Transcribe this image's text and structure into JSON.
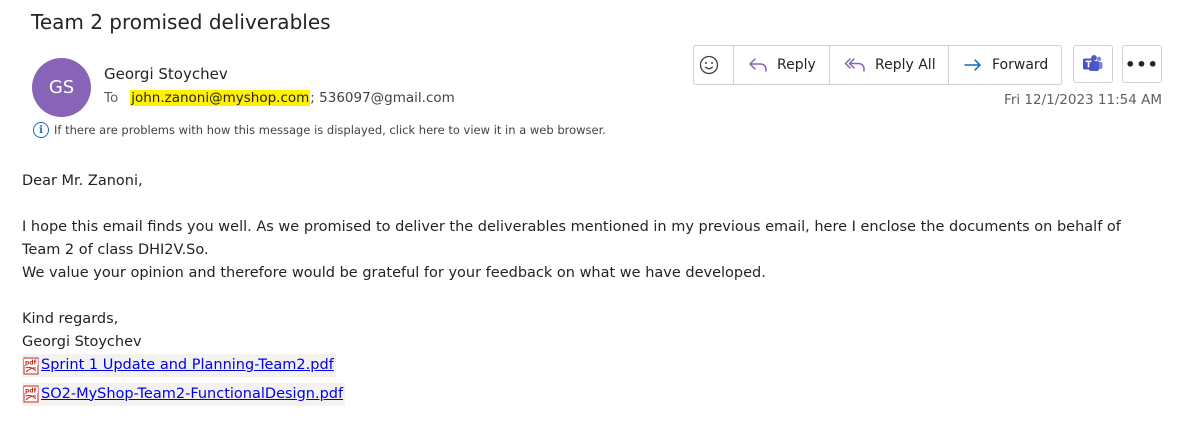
{
  "email": {
    "subject": "Team 2 promised deliverables",
    "avatar_initials": "GS",
    "sender": "Georgi Stoychev",
    "to_label": "To",
    "to_highlighted": "john.zanoni@myshop.com",
    "to_rest": "; 536097@gmail.com",
    "date": "Fri 12/1/2023 11:54 AM",
    "info_notice": "If there are problems with how this message is displayed, click here to view it in a web browser."
  },
  "toolbar": {
    "emoji_icon": "emoji-icon",
    "reply_label": "Reply",
    "reply_all_label": "Reply All",
    "forward_label": "Forward",
    "teams_icon": "teams-icon",
    "more_label": "•••"
  },
  "body": {
    "greeting": "Dear Mr. Zanoni,",
    "paragraph_1": "I hope this email finds you well. As we promised to deliver the deliverables mentioned in my previous email, here I enclose the documents on behalf of Team 2 of class DHI2V.So.",
    "paragraph_2": "We value your opinion and therefore would be grateful for your feedback on what we have developed.",
    "closing": "Kind regards,",
    "signature": "Georgi Stoychev"
  },
  "attachments": [
    {
      "name": "Sprint 1 Update and Planning-Team2.pdf",
      "icon": "pdf-icon"
    },
    {
      "name": "SO2-MyShop-Team2-FunctionalDesign.pdf",
      "icon": "pdf-icon"
    }
  ],
  "colors": {
    "avatar": "#8764b8",
    "highlight": "#fff100",
    "link": "#0000ee",
    "accent": "#0f6cbd"
  }
}
